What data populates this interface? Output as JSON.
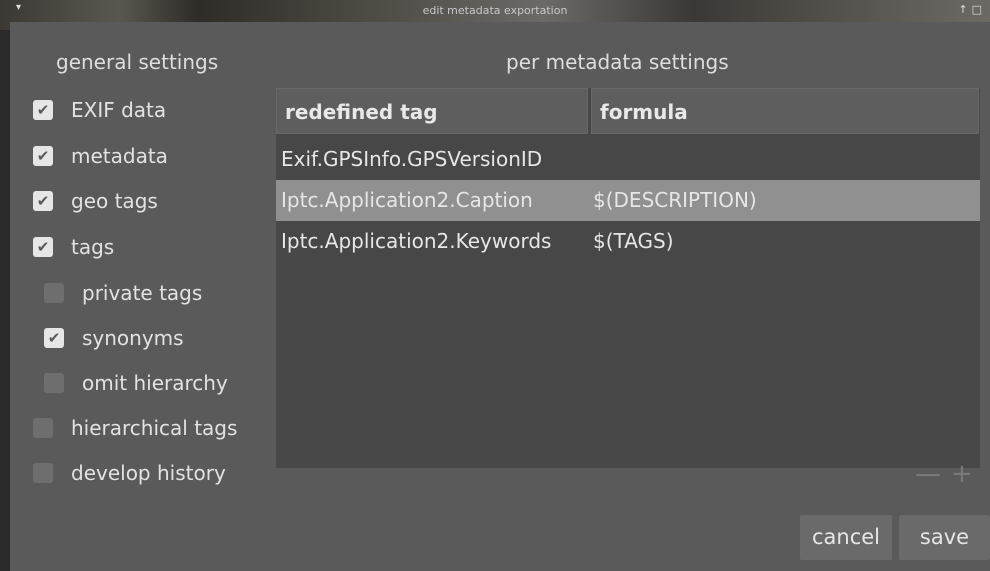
{
  "window": {
    "title": "edit metadata exportation"
  },
  "general": {
    "title": "general settings",
    "options": [
      {
        "label": "EXIF data",
        "checked": true
      },
      {
        "label": "metadata",
        "checked": true
      },
      {
        "label": "geo tags",
        "checked": true
      },
      {
        "label": "tags",
        "checked": true
      },
      {
        "label": "private tags",
        "checked": false
      },
      {
        "label": "synonyms",
        "checked": true
      },
      {
        "label": "omit hierarchy",
        "checked": false
      },
      {
        "label": "hierarchical tags",
        "checked": false
      },
      {
        "label": "develop history",
        "checked": false
      }
    ]
  },
  "per_metadata": {
    "title": "per metadata settings",
    "columns": [
      "redefined tag",
      "formula"
    ],
    "rows": [
      {
        "tag": "Exif.GPSInfo.GPSVersionID",
        "formula": "",
        "selected": false
      },
      {
        "tag": "Iptc.Application2.Caption",
        "formula": "$(DESCRIPTION)",
        "selected": true
      },
      {
        "tag": "Iptc.Application2.Keywords",
        "formula": "$(TAGS)",
        "selected": false
      }
    ],
    "remove_label": "—",
    "add_label": "+"
  },
  "buttons": {
    "cancel": "cancel",
    "save": "save"
  }
}
